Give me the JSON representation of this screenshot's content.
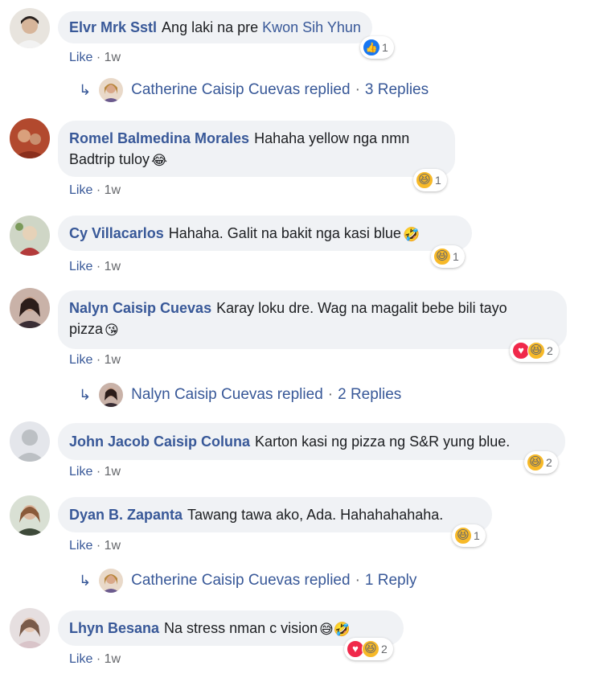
{
  "colors": {
    "link": "#385898",
    "bubble": "#f0f2f5",
    "meta": "#65676b",
    "like_blue": "#1877f2",
    "love_red": "#f0284a",
    "haha_yellow": "#f7b928"
  },
  "comments": [
    {
      "author": "Elvr Mrk Sstl",
      "text": "Ang laki na pre",
      "mention": "Kwon Sih Yhun",
      "emoji": "",
      "text2": "",
      "reactions": [
        "like-icon"
      ],
      "reaction_count": "1",
      "like": "Like",
      "sep": "·",
      "time": "1w",
      "replies": {
        "arrow": "↳",
        "name": "Catherine Caisip Cuevas replied",
        "sep": "·",
        "count": "3 Replies"
      }
    },
    {
      "author": "Romel Balmedina Morales",
      "text": "Hahaha yellow nga nmn",
      "text2": "Badtrip tuloy",
      "emoji": "😂",
      "reactions": [
        "haha-icon"
      ],
      "reaction_count": "1",
      "like": "Like",
      "sep": "·",
      "time": "1w"
    },
    {
      "author": "Cy Villacarlos",
      "text": "Hahaha. Galit na bakit nga kasi blue",
      "emoji": "🤣",
      "reactions": [
        "haha-icon"
      ],
      "reaction_count": "1",
      "like": "Like",
      "sep": "·",
      "time": "1w"
    },
    {
      "author": "Nalyn Caisip Cuevas",
      "text": "Karay loku dre. Wag na magalit bebe bili tayo",
      "text2": "pizza",
      "emoji": "😘",
      "reactions": [
        "love-icon",
        "haha-icon"
      ],
      "reaction_count": "2",
      "like": "Like",
      "sep": "·",
      "time": "1w",
      "replies": {
        "arrow": "↳",
        "name": "Nalyn Caisip Cuevas replied",
        "sep": "·",
        "count": "2 Replies"
      }
    },
    {
      "author": "John Jacob Caisip Coluna",
      "text": "Karton kasi ng pizza ng S&R yung blue.",
      "reactions": [
        "haha-icon"
      ],
      "reaction_count": "2",
      "like": "Like",
      "sep": "·",
      "time": "1w"
    },
    {
      "author": "Dyan B. Zapanta",
      "text": "Tawang tawa ako, Ada. Hahahahahaha.",
      "reactions": [
        "haha-icon"
      ],
      "reaction_count": "1",
      "like": "Like",
      "sep": "·",
      "time": "1w",
      "replies": {
        "arrow": "↳",
        "name": "Catherine Caisip Cuevas replied",
        "sep": "·",
        "count": "1 Reply"
      }
    },
    {
      "author": "Lhyn Besana",
      "text": "Na stress nman c vision",
      "emoji": "😅🤣",
      "reactions": [
        "love-icon",
        "haha-icon"
      ],
      "reaction_count": "2",
      "like": "Like",
      "sep": "·",
      "time": "1w"
    }
  ]
}
